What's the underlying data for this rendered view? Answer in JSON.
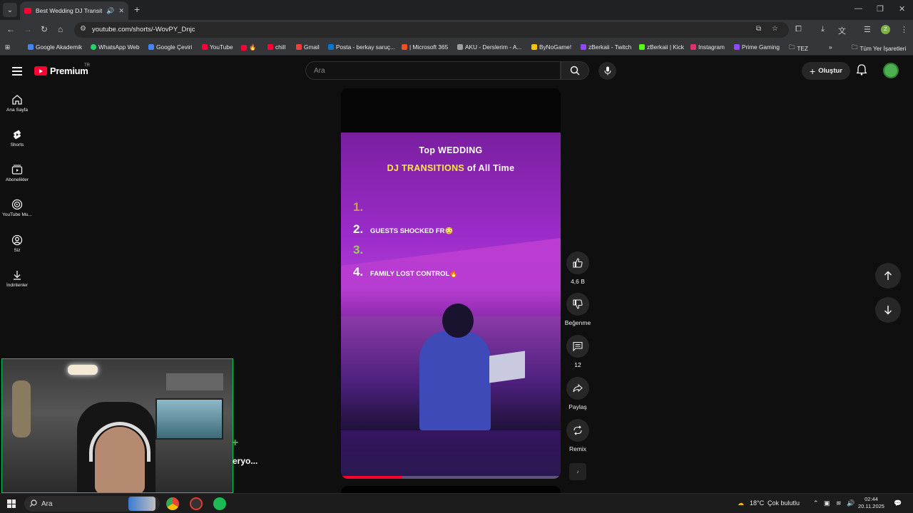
{
  "browser": {
    "tab_title": "Best Wedding DJ Transition",
    "url": "youtube.com/shorts/-WovPY_Dnjc",
    "bookmarks": [
      {
        "label": "Google Akademik",
        "icon": "google-scholar-icon",
        "color": "#4285f4"
      },
      {
        "label": "WhatsApp Web",
        "icon": "whatsapp-icon",
        "color": "#25d366"
      },
      {
        "label": "Google Çeviri",
        "icon": "google-translate-icon",
        "color": "#4285f4"
      },
      {
        "label": "YouTube",
        "icon": "youtube-icon",
        "color": "#ff0033"
      },
      {
        "label": "",
        "icon": "youtube-icon",
        "color": "#ff0033"
      },
      {
        "label": "chill",
        "icon": "youtube-icon",
        "color": "#ff0033"
      },
      {
        "label": "Gmail",
        "icon": "gmail-icon",
        "color": "#ea4335"
      },
      {
        "label": "Posta - berkay saruç...",
        "icon": "outlook-icon",
        "color": "#0078d4"
      },
      {
        "label": "| Microsoft 365",
        "icon": "microsoft-icon",
        "color": "#f25022"
      },
      {
        "label": "AKU - Derslerim - A...",
        "icon": "aku-icon",
        "color": "#9e9e9e"
      },
      {
        "label": "ByNoGame!",
        "icon": "bynogame-icon",
        "color": "#ffc107"
      },
      {
        "label": "zBerkaii - Twitch",
        "icon": "twitch-icon",
        "color": "#9146ff"
      },
      {
        "label": "zBerkaii | Kick",
        "icon": "kick-icon",
        "color": "#53fc18"
      },
      {
        "label": "Instagram",
        "icon": "instagram-icon",
        "color": "#e1306c"
      },
      {
        "label": "Prime Gaming",
        "icon": "prime-gaming-icon",
        "color": "#9146ff"
      },
      {
        "label": "TEZ",
        "icon": "folder-icon",
        "color": "#c4c7c5"
      }
    ],
    "all_bookmarks": "Tüm Yer İşaretleri"
  },
  "youtube": {
    "logo_text": "Premium",
    "logo_region": "TR",
    "search_placeholder": "Ara",
    "create_label": "Oluştur",
    "sidebar": [
      {
        "label": "Ana Sayfa",
        "icon": "home-icon"
      },
      {
        "label": "Shorts",
        "icon": "shorts-icon"
      },
      {
        "label": "Abonelikler",
        "icon": "subscriptions-icon"
      },
      {
        "label": "YouTube Mu...",
        "icon": "youtube-music-icon"
      },
      {
        "label": "Siz",
        "icon": "account-icon"
      },
      {
        "label": "İndirilenler",
        "icon": "download-icon"
      }
    ],
    "short": {
      "title_line1": "Top WEDDING",
      "title_line2a": "DJ TRANSITIONS",
      "title_line2b": " of All Time",
      "items": [
        {
          "num": "1.",
          "text": "",
          "color": "#c8a24a"
        },
        {
          "num": "2.",
          "text": "guests shocked fr😳",
          "color": "#ffffff"
        },
        {
          "num": "3.",
          "text": "",
          "color": "#9ccc65"
        },
        {
          "num": "4.",
          "text": "family lost control🔥",
          "color": "#ffffff"
        }
      ],
      "progress_fraction": 0.28,
      "channel_partial": "eryo..."
    },
    "actions": {
      "likes": "4,6 B",
      "dislike": "Beğenme",
      "comments": "12",
      "share": "Paylaş",
      "remix": "Remix"
    }
  },
  "taskbar": {
    "search_placeholder": "Ara",
    "weather": "18°C",
    "weather_desc": "Çok bulutlu",
    "time": "02:44",
    "date": "20.11.2025"
  }
}
